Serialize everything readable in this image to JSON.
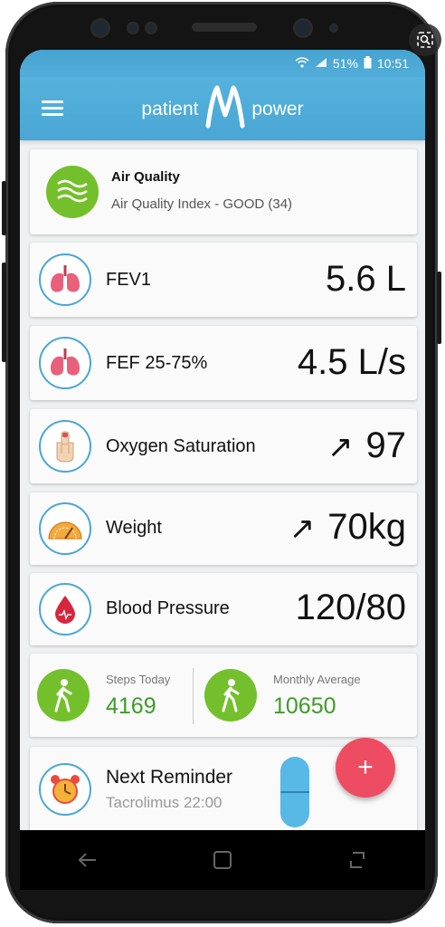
{
  "status_bar": {
    "battery": "51%",
    "time": "10:51"
  },
  "header": {
    "brand_left": "patient",
    "brand_right": "power"
  },
  "air_quality": {
    "title": "Air Quality",
    "subtitle": "Air Quality Index - GOOD (34)"
  },
  "metrics": [
    {
      "label": "FEV1",
      "value": "5.6 L",
      "trend": ""
    },
    {
      "label": "FEF 25-75%",
      "value": "4.5 L/s",
      "trend": ""
    },
    {
      "label": "Oxygen Saturation",
      "value": "97",
      "trend": "↗"
    },
    {
      "label": "Weight",
      "value": "70kg",
      "trend": "↗"
    },
    {
      "label": "Blood Pressure",
      "value": "120/80",
      "trend": ""
    }
  ],
  "steps": {
    "today_label": "Steps Today",
    "today_value": "4169",
    "monthly_label": "Monthly Average",
    "monthly_value": "10650"
  },
  "reminder": {
    "title": "Next Reminder",
    "subtitle": "Tacrolimus 22:00"
  },
  "fab": {
    "label": "+"
  },
  "colors": {
    "primary": "#4aa6d4",
    "accent": "#ee4c62",
    "green": "#73c02c",
    "steps_text": "#3f9a2a"
  },
  "icons": {
    "air_quality": "air-waves-icon",
    "fev1": "lungs-icon",
    "fef": "lungs-icon",
    "oxygen": "finger-sensor-icon",
    "weight": "scale-icon",
    "blood_pressure": "blood-drop-icon",
    "steps": "walking-person-icon",
    "reminder": "alarm-clock-icon"
  }
}
